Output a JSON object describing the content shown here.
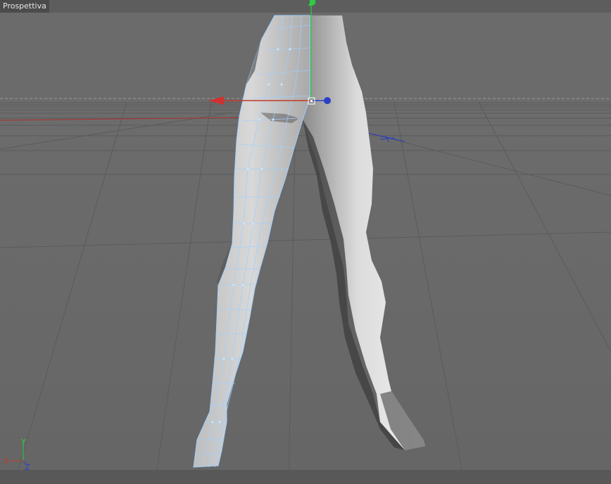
{
  "viewport": {
    "label": "Prospettiva"
  },
  "axis_gizmo": {
    "x_label": "X",
    "y_label": "Y",
    "z_label": "Z",
    "x_color": "#c0392b",
    "y_color": "#2ecc40",
    "z_color": "#2b3fc8"
  },
  "colors": {
    "background": "#6b6b6b",
    "grid": "#5a5a5a",
    "horizon": "#8a8a8a",
    "mesh_selected_wire": "#9fd0ff",
    "mesh_shade": "#cfcfcf"
  },
  "object": {
    "name_icon": "legs-mesh"
  }
}
